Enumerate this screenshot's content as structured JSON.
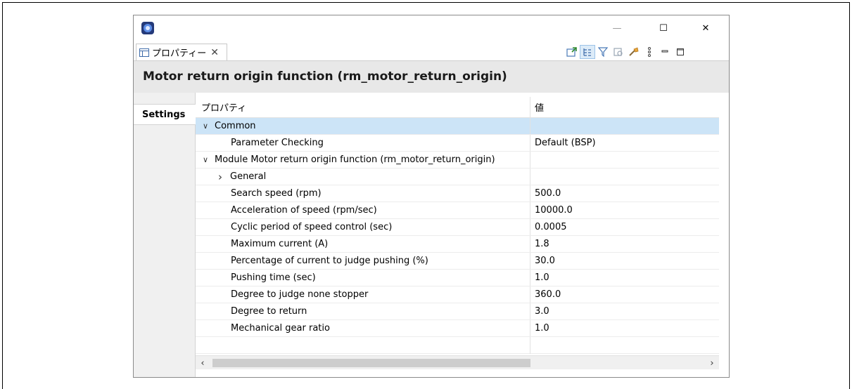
{
  "window": {
    "min_glyph": "—",
    "max_glyph": "☐",
    "close_glyph": "✕"
  },
  "tab": {
    "label": "プロパティー",
    "close_glyph": "✕"
  },
  "toolbar": {
    "icons": [
      "pin-to-editor-icon",
      "show-categories-icon",
      "filter-icon",
      "show-advanced-icon",
      "restore-default-icon",
      "view-menu-icon",
      "minimize-icon",
      "maximize-icon"
    ]
  },
  "header": {
    "title": "Motor return origin function (rm_motor_return_origin)"
  },
  "side": {
    "tab_label": "Settings"
  },
  "table": {
    "col_property": "プロパティ",
    "col_value": "値",
    "rows": [
      {
        "label": "Common",
        "value": "",
        "level": 0,
        "expander": "open"
      },
      {
        "label": "Parameter Checking",
        "value": "Default (BSP)",
        "level": 2,
        "expander": ""
      },
      {
        "label": "Module  Motor return origin function (rm_motor_return_origin)",
        "value": "",
        "level": 0,
        "expander": "open"
      },
      {
        "label": "General",
        "value": "",
        "level": 1,
        "expander": "closed"
      },
      {
        "label": "Search speed (rpm)",
        "value": "500.0",
        "level": 2,
        "expander": ""
      },
      {
        "label": "Acceleration of speed (rpm/sec)",
        "value": "10000.0",
        "level": 2,
        "expander": ""
      },
      {
        "label": "Cyclic period of speed control (sec)",
        "value": "0.0005",
        "level": 2,
        "expander": ""
      },
      {
        "label": "Maximum current (A)",
        "value": "1.8",
        "level": 2,
        "expander": ""
      },
      {
        "label": "Percentage of current to judge pushing (%)",
        "value": "30.0",
        "level": 2,
        "expander": ""
      },
      {
        "label": "Pushing time (sec)",
        "value": "1.0",
        "level": 2,
        "expander": ""
      },
      {
        "label": "Degree to judge none stopper",
        "value": "360.0",
        "level": 2,
        "expander": ""
      },
      {
        "label": "Degree to return",
        "value": "3.0",
        "level": 2,
        "expander": ""
      },
      {
        "label": "Mechanical gear ratio",
        "value": "1.0",
        "level": 2,
        "expander": ""
      }
    ]
  },
  "scrollbar": {
    "left_glyph": "‹",
    "right_glyph": "›"
  }
}
